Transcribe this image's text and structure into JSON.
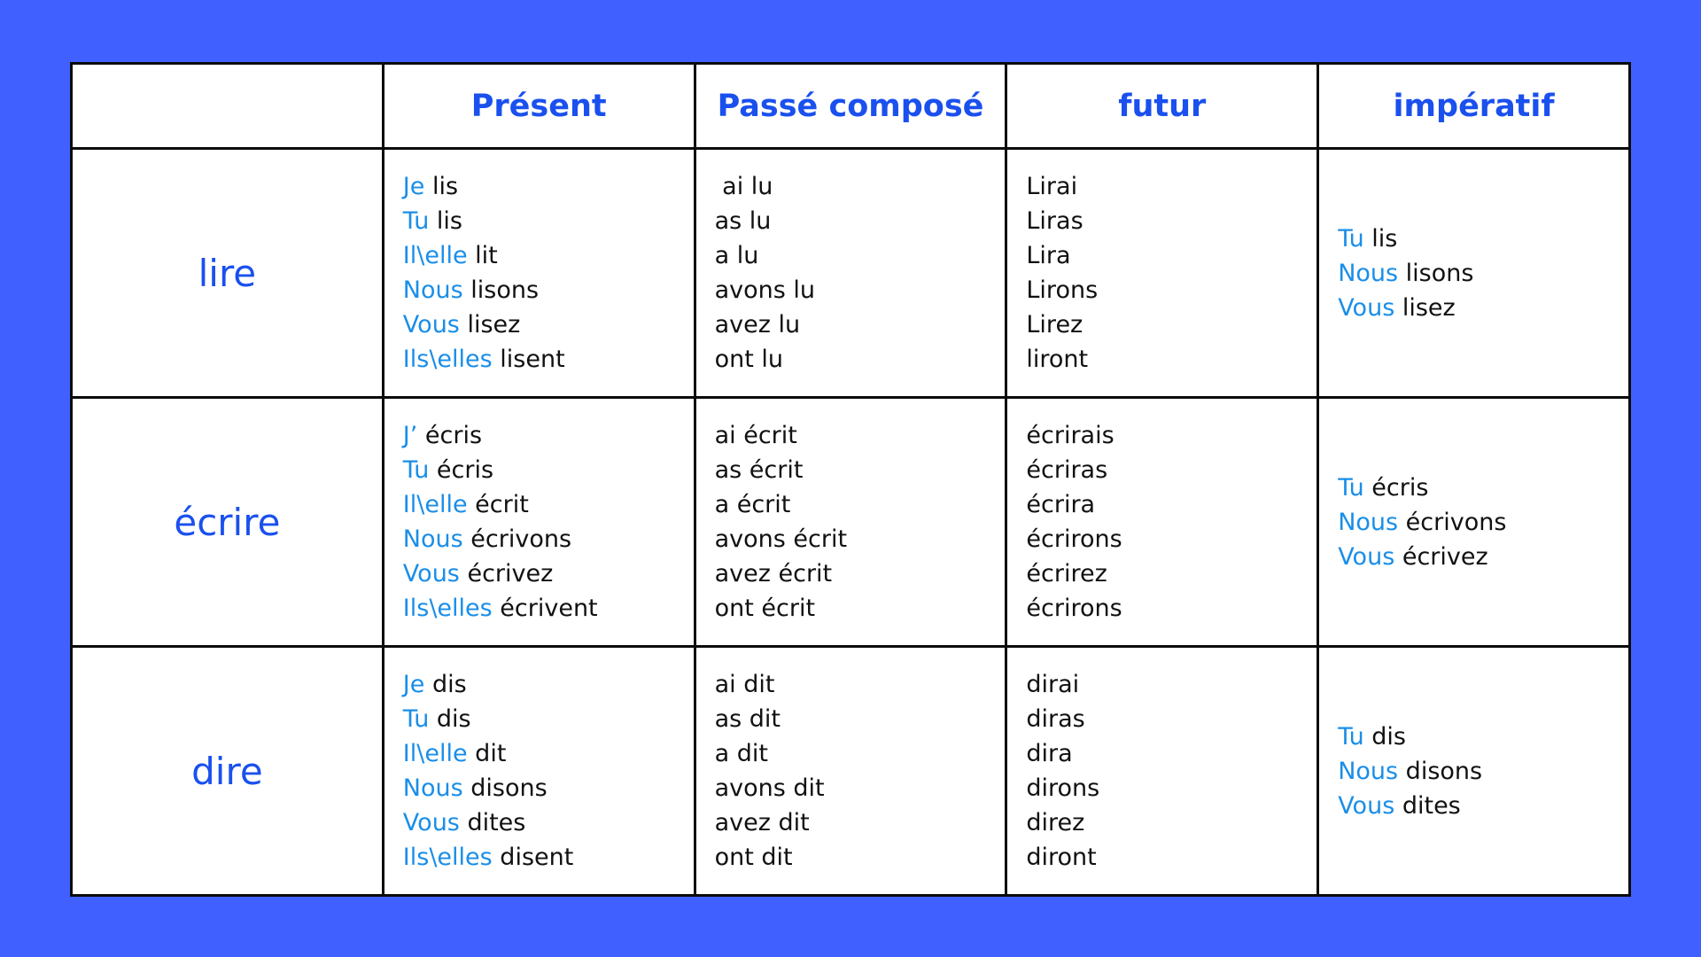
{
  "headers": [
    "",
    "Présent",
    "Passé composé",
    "futur",
    "impératif"
  ],
  "rows": [
    {
      "verb": "lire",
      "present": [
        {
          "pronoun": "Je",
          "form": " lis"
        },
        {
          "pronoun": "Tu",
          "form": " lis"
        },
        {
          "pronoun": "Il\\elle",
          "form": " lit"
        },
        {
          "pronoun": "Nous",
          "form": " lisons"
        },
        {
          "pronoun": "Vous",
          "form": " lisez"
        },
        {
          "pronoun": "Ils\\elles",
          "form": " lisent"
        }
      ],
      "passe_compose": [
        " ai lu",
        "as lu",
        "a lu",
        "avons lu",
        "avez lu",
        "ont lu"
      ],
      "futur": [
        "Lirai",
        "Liras",
        "Lira",
        "Lirons",
        "Lirez",
        "liront"
      ],
      "imperatif": [
        {
          "pronoun": "Tu",
          "form": " lis"
        },
        {
          "pronoun": "Nous",
          "form": " lisons"
        },
        {
          "pronoun": "Vous",
          "form": " lisez"
        }
      ]
    },
    {
      "verb": "écrire",
      "present": [
        {
          "pronoun": "J’",
          "form": " écris"
        },
        {
          "pronoun": "Tu",
          "form": " écris"
        },
        {
          "pronoun": "Il\\elle",
          "form": " écrit"
        },
        {
          "pronoun": "Nous",
          "form": " écrivons"
        },
        {
          "pronoun": "Vous",
          "form": " écrivez"
        },
        {
          "pronoun": "Ils\\elles",
          "form": " écrivent"
        }
      ],
      "passe_compose": [
        "ai écrit",
        "as écrit",
        "a écrit",
        "avons écrit",
        "avez écrit",
        "ont écrit"
      ],
      "futur": [
        "écrirais",
        "écriras",
        "écrira",
        "écrirons",
        "écrirez",
        "écrirons"
      ],
      "imperatif": [
        {
          "pronoun": "Tu",
          "form": " écris"
        },
        {
          "pronoun": "Nous",
          "form": " écrivons"
        },
        {
          "pronoun": "Vous",
          "form": " écrivez"
        }
      ]
    },
    {
      "verb": "dire",
      "present": [
        {
          "pronoun": "Je",
          "form": " dis"
        },
        {
          "pronoun": "Tu",
          "form": " dis"
        },
        {
          "pronoun": "Il\\elle",
          "form": " dit"
        },
        {
          "pronoun": "Nous",
          "form": " disons"
        },
        {
          "pronoun": "Vous",
          "form": " dites"
        },
        {
          "pronoun": "Ils\\elles",
          "form": " disent"
        }
      ],
      "passe_compose": [
        "ai dit",
        "as dit",
        "a dit",
        "avons dit",
        "avez dit",
        "ont dit"
      ],
      "futur": [
        "dirai",
        "diras",
        "dira",
        "dirons",
        "direz",
        "diront"
      ],
      "imperatif": [
        {
          "pronoun": "Tu",
          "form": " dis"
        },
        {
          "pronoun": "Nous",
          "form": " disons"
        },
        {
          "pronoun": "Vous",
          "form": " dites"
        }
      ]
    }
  ],
  "colors": {
    "background": "#4060ff",
    "header_text": "#1a50ee",
    "verb_text": "#1a50ee",
    "pronoun_text": "#1a8ee8",
    "form_text": "#111111",
    "table_border": "#0b0b0b",
    "table_background": "#ffffff"
  }
}
